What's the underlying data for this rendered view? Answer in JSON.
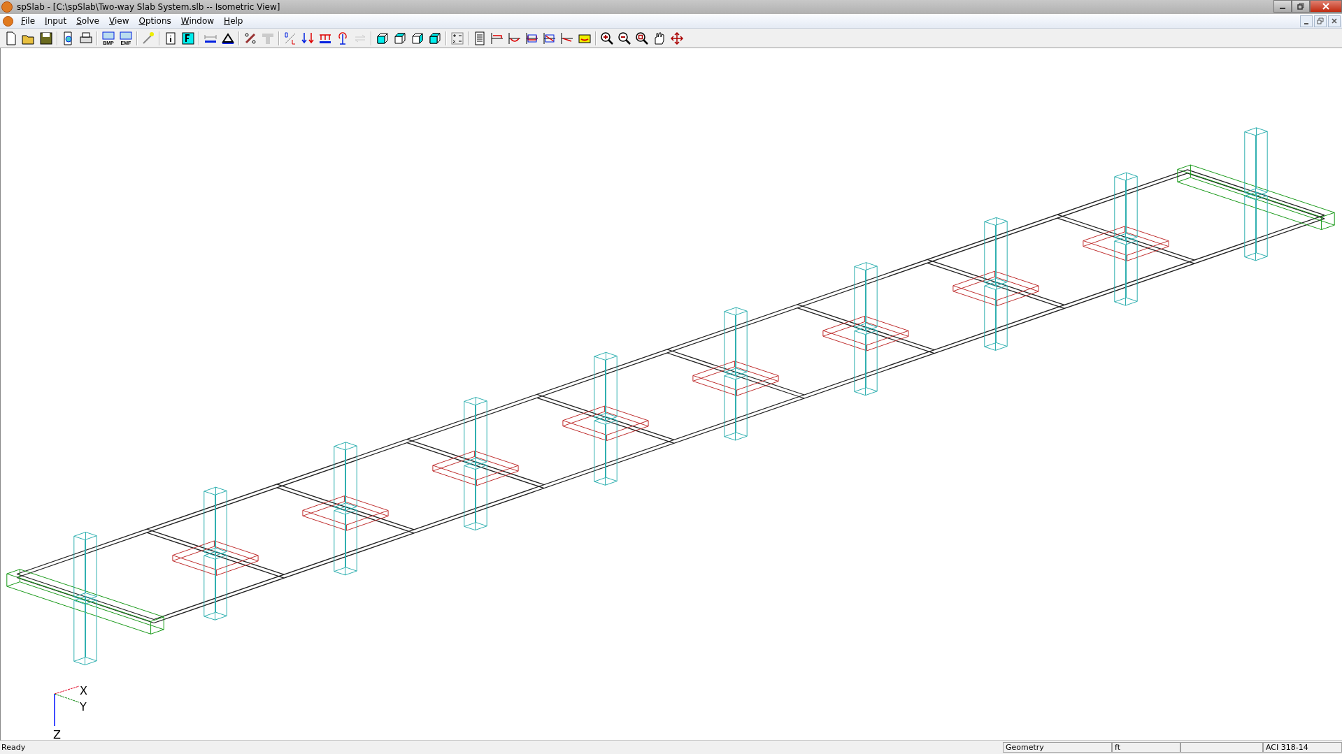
{
  "window": {
    "title": "spSlab - [C:\\spSlab\\Two-way Slab System.slb -- Isometric View]"
  },
  "menu": [
    {
      "label": "File"
    },
    {
      "label": "Input"
    },
    {
      "label": "Solve"
    },
    {
      "label": "View"
    },
    {
      "label": "Options"
    },
    {
      "label": "Window"
    },
    {
      "label": "Help"
    }
  ],
  "toolbar": [
    {
      "kind": "new",
      "disabled": false
    },
    {
      "kind": "open",
      "disabled": false
    },
    {
      "kind": "save",
      "disabled": false
    },
    {
      "kind": "sep"
    },
    {
      "kind": "preview",
      "disabled": false
    },
    {
      "kind": "print",
      "disabled": false
    },
    {
      "kind": "sep"
    },
    {
      "kind": "export",
      "label": "BMP",
      "disabled": false
    },
    {
      "kind": "export",
      "label": "EMF",
      "disabled": false
    },
    {
      "kind": "sep"
    },
    {
      "kind": "wizard",
      "disabled": false
    },
    {
      "kind": "sep"
    },
    {
      "kind": "info",
      "disabled": false
    },
    {
      "kind": "material",
      "disabled": false
    },
    {
      "kind": "sep"
    },
    {
      "kind": "span",
      "disabled": false
    },
    {
      "kind": "support",
      "disabled": false
    },
    {
      "kind": "sep"
    },
    {
      "kind": "rebar",
      "disabled": false
    },
    {
      "kind": "tbeam",
      "disabled": true
    },
    {
      "kind": "sep"
    },
    {
      "kind": "dl",
      "disabled": false
    },
    {
      "kind": "loads",
      "disabled": false
    },
    {
      "kind": "lineload",
      "disabled": false
    },
    {
      "kind": "moment",
      "disabled": false
    },
    {
      "kind": "swap",
      "disabled": true
    },
    {
      "kind": "sep"
    },
    {
      "kind": "view",
      "disabled": false
    },
    {
      "kind": "view",
      "disabled": false
    },
    {
      "kind": "view",
      "disabled": false
    },
    {
      "kind": "view",
      "disabled": false
    },
    {
      "kind": "sep"
    },
    {
      "kind": "calc",
      "disabled": false
    },
    {
      "kind": "sep"
    },
    {
      "kind": "report",
      "disabled": false
    },
    {
      "kind": "diagram",
      "disabled": false
    },
    {
      "kind": "diagram",
      "disabled": false
    },
    {
      "kind": "diagram",
      "disabled": false
    },
    {
      "kind": "diagram",
      "disabled": false
    },
    {
      "kind": "diagram",
      "disabled": false
    },
    {
      "kind": "deflection",
      "disabled": false
    },
    {
      "kind": "sep"
    },
    {
      "kind": "zoomin",
      "disabled": false
    },
    {
      "kind": "zoomout",
      "disabled": false
    },
    {
      "kind": "zoomwin",
      "disabled": false
    },
    {
      "kind": "hand",
      "disabled": false
    },
    {
      "kind": "move",
      "disabled": false
    }
  ],
  "axes": {
    "x_label": "X",
    "y_label": "Y",
    "z_label": "Z"
  },
  "status_bar": {
    "message": "Ready",
    "panes": [
      "Geometry",
      "ft",
      "ACI 318-14"
    ]
  }
}
